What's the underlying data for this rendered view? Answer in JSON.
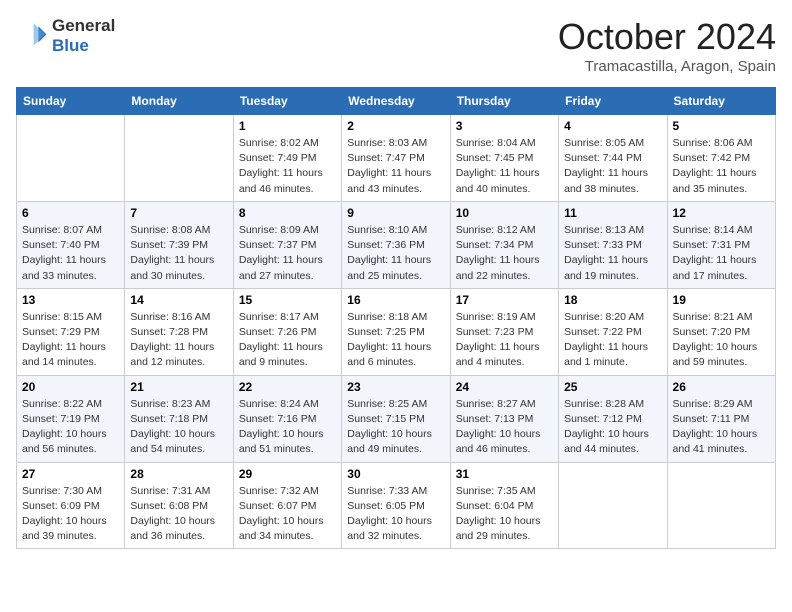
{
  "logo": {
    "line1": "General",
    "line2": "Blue"
  },
  "title": "October 2024",
  "subtitle": "Tramacastilla, Aragon, Spain",
  "weekdays": [
    "Sunday",
    "Monday",
    "Tuesday",
    "Wednesday",
    "Thursday",
    "Friday",
    "Saturday"
  ],
  "weeks": [
    [
      {
        "day": "",
        "info": ""
      },
      {
        "day": "",
        "info": ""
      },
      {
        "day": "1",
        "info": "Sunrise: 8:02 AM\nSunset: 7:49 PM\nDaylight: 11 hours and 46 minutes."
      },
      {
        "day": "2",
        "info": "Sunrise: 8:03 AM\nSunset: 7:47 PM\nDaylight: 11 hours and 43 minutes."
      },
      {
        "day": "3",
        "info": "Sunrise: 8:04 AM\nSunset: 7:45 PM\nDaylight: 11 hours and 40 minutes."
      },
      {
        "day": "4",
        "info": "Sunrise: 8:05 AM\nSunset: 7:44 PM\nDaylight: 11 hours and 38 minutes."
      },
      {
        "day": "5",
        "info": "Sunrise: 8:06 AM\nSunset: 7:42 PM\nDaylight: 11 hours and 35 minutes."
      }
    ],
    [
      {
        "day": "6",
        "info": "Sunrise: 8:07 AM\nSunset: 7:40 PM\nDaylight: 11 hours and 33 minutes."
      },
      {
        "day": "7",
        "info": "Sunrise: 8:08 AM\nSunset: 7:39 PM\nDaylight: 11 hours and 30 minutes."
      },
      {
        "day": "8",
        "info": "Sunrise: 8:09 AM\nSunset: 7:37 PM\nDaylight: 11 hours and 27 minutes."
      },
      {
        "day": "9",
        "info": "Sunrise: 8:10 AM\nSunset: 7:36 PM\nDaylight: 11 hours and 25 minutes."
      },
      {
        "day": "10",
        "info": "Sunrise: 8:12 AM\nSunset: 7:34 PM\nDaylight: 11 hours and 22 minutes."
      },
      {
        "day": "11",
        "info": "Sunrise: 8:13 AM\nSunset: 7:33 PM\nDaylight: 11 hours and 19 minutes."
      },
      {
        "day": "12",
        "info": "Sunrise: 8:14 AM\nSunset: 7:31 PM\nDaylight: 11 hours and 17 minutes."
      }
    ],
    [
      {
        "day": "13",
        "info": "Sunrise: 8:15 AM\nSunset: 7:29 PM\nDaylight: 11 hours and 14 minutes."
      },
      {
        "day": "14",
        "info": "Sunrise: 8:16 AM\nSunset: 7:28 PM\nDaylight: 11 hours and 12 minutes."
      },
      {
        "day": "15",
        "info": "Sunrise: 8:17 AM\nSunset: 7:26 PM\nDaylight: 11 hours and 9 minutes."
      },
      {
        "day": "16",
        "info": "Sunrise: 8:18 AM\nSunset: 7:25 PM\nDaylight: 11 hours and 6 minutes."
      },
      {
        "day": "17",
        "info": "Sunrise: 8:19 AM\nSunset: 7:23 PM\nDaylight: 11 hours and 4 minutes."
      },
      {
        "day": "18",
        "info": "Sunrise: 8:20 AM\nSunset: 7:22 PM\nDaylight: 11 hours and 1 minute."
      },
      {
        "day": "19",
        "info": "Sunrise: 8:21 AM\nSunset: 7:20 PM\nDaylight: 10 hours and 59 minutes."
      }
    ],
    [
      {
        "day": "20",
        "info": "Sunrise: 8:22 AM\nSunset: 7:19 PM\nDaylight: 10 hours and 56 minutes."
      },
      {
        "day": "21",
        "info": "Sunrise: 8:23 AM\nSunset: 7:18 PM\nDaylight: 10 hours and 54 minutes."
      },
      {
        "day": "22",
        "info": "Sunrise: 8:24 AM\nSunset: 7:16 PM\nDaylight: 10 hours and 51 minutes."
      },
      {
        "day": "23",
        "info": "Sunrise: 8:25 AM\nSunset: 7:15 PM\nDaylight: 10 hours and 49 minutes."
      },
      {
        "day": "24",
        "info": "Sunrise: 8:27 AM\nSunset: 7:13 PM\nDaylight: 10 hours and 46 minutes."
      },
      {
        "day": "25",
        "info": "Sunrise: 8:28 AM\nSunset: 7:12 PM\nDaylight: 10 hours and 44 minutes."
      },
      {
        "day": "26",
        "info": "Sunrise: 8:29 AM\nSunset: 7:11 PM\nDaylight: 10 hours and 41 minutes."
      }
    ],
    [
      {
        "day": "27",
        "info": "Sunrise: 7:30 AM\nSunset: 6:09 PM\nDaylight: 10 hours and 39 minutes."
      },
      {
        "day": "28",
        "info": "Sunrise: 7:31 AM\nSunset: 6:08 PM\nDaylight: 10 hours and 36 minutes."
      },
      {
        "day": "29",
        "info": "Sunrise: 7:32 AM\nSunset: 6:07 PM\nDaylight: 10 hours and 34 minutes."
      },
      {
        "day": "30",
        "info": "Sunrise: 7:33 AM\nSunset: 6:05 PM\nDaylight: 10 hours and 32 minutes."
      },
      {
        "day": "31",
        "info": "Sunrise: 7:35 AM\nSunset: 6:04 PM\nDaylight: 10 hours and 29 minutes."
      },
      {
        "day": "",
        "info": ""
      },
      {
        "day": "",
        "info": ""
      }
    ]
  ]
}
